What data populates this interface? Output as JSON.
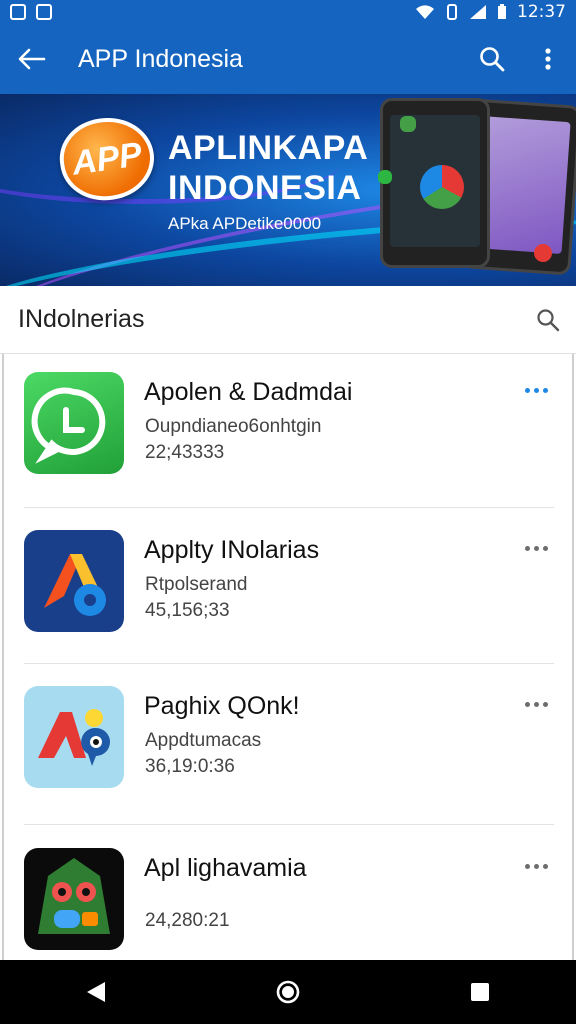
{
  "status_bar": {
    "time": "12:37",
    "icons": [
      "notification-icon",
      "image-icon",
      "wifi-icon",
      "vibrate-icon",
      "signal-icon",
      "battery-icon"
    ]
  },
  "app_bar": {
    "title": "APP Indonesia",
    "back_icon": "arrow-back-icon",
    "search_icon": "search-icon",
    "more_icon": "more-vert-icon",
    "color": "#1565c0"
  },
  "banner": {
    "logo_text": "APP",
    "title_line1": "APLINKAPA",
    "title_line2": "INDONESIA",
    "subtitle": "APka APDetike0000"
  },
  "section": {
    "label": "INdolnerias",
    "search_icon": "search-icon"
  },
  "apps": [
    {
      "name": "Apolen & Dadmdai",
      "subtitle": "Oupndianeo6onhtgin",
      "count": "22;43333",
      "icon": "chat-bubble-icon",
      "more_accent": true
    },
    {
      "name": "Applty INolarias",
      "subtitle": "Rtpolserand",
      "count": "45,156;33",
      "icon": "arrow-a-icon",
      "more_accent": false
    },
    {
      "name": "Paghix QOnk!",
      "subtitle": "Appdtumacas",
      "count": "36,19:0:36",
      "icon": "red-a-pin-icon",
      "more_accent": false
    },
    {
      "name": "Apl lighavamia",
      "subtitle": "",
      "count": "24,280:21",
      "icon": "monster-face-icon",
      "more_accent": false
    }
  ],
  "nav_bar": {
    "back_icon": "nav-back-icon",
    "home_icon": "nav-home-icon",
    "recents_icon": "nav-recents-icon"
  },
  "colors": {
    "accent_blue": "#1e88e5",
    "whatsapp_green": "#2db742"
  }
}
